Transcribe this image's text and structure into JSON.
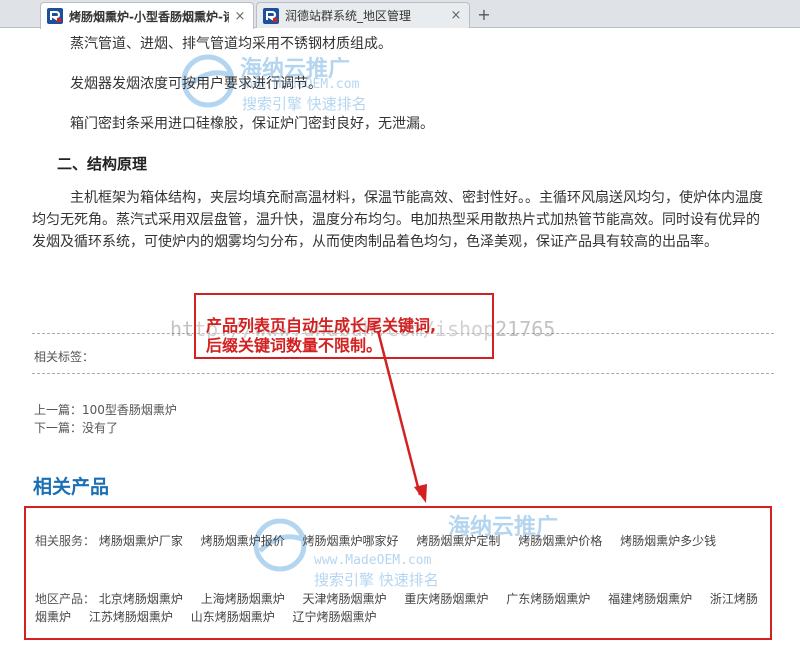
{
  "tabs": [
    {
      "label": "烤肠烟熏炉-小型香肠烟熏炉-诸城",
      "close": "×"
    },
    {
      "label": "润德站群系统_地区管理",
      "close": "×"
    }
  ],
  "new_tab": "+",
  "paragraphs": [
    "蒸汽管道、进烟、排气管道均采用不锈钢材质组成。",
    "发烟器发烟浓度可按用户要求进行调节。",
    "箱门密封条采用进口硅橡胶，保证炉门密封良好，无泄漏。"
  ],
  "section_heading": "二、结构原理",
  "body_text": "主机框架为箱体结构，夹层均填充耐高温材料，保温节能高效、密封性好。。主循环风扇送风均匀，使炉体内温度均匀无死角。蒸汽式采用双层盘管，温升快，温度分布均匀。电加热型采用散热片式加热管节能高效。同时设有优异的发烟及循环系统，可使炉内的烟雾均匀分布，从而使肉制品着色均匀，色泽美观，保证产品具有较高的出品率。",
  "tags_label": "相关标签：",
  "prev": "上一篇：100型香肠烟熏炉",
  "next": "下一篇：没有了",
  "related_title": "相关产品",
  "services": {
    "label": "相关服务：",
    "items": [
      "烤肠烟熏炉厂家",
      "烤肠烟熏炉报价",
      "烤肠烟熏炉哪家好",
      "烤肠烟熏炉定制",
      "烤肠烟熏炉价格",
      "烤肠烟熏炉多少钱"
    ]
  },
  "regions": {
    "label": "地区产品：",
    "items": [
      "北京烤肠烟熏炉",
      "上海烤肠烟熏炉",
      "天津烤肠烟熏炉",
      "重庆烤肠烟熏炉",
      "广东烤肠烟熏炉",
      "福建烤肠烟熏炉",
      "浙江烤肠烟熏炉",
      "江苏烤肠烟熏炉",
      "山东烤肠烟熏炉",
      "辽宁烤肠烟熏炉"
    ]
  },
  "callout": {
    "line1": "产品列表页自动生成长尾关键词,",
    "line2": "后缀关键词数量不限制。"
  },
  "watermark": {
    "url": "http://www.uhubuh.com/ishop21765",
    "name": "海纳云推广",
    "site": "www.MadeOEM.com",
    "slogan": "搜索引擎 快速排名"
  },
  "colors": {
    "accent": "#d32020",
    "title_blue": "#1b6fb5"
  }
}
